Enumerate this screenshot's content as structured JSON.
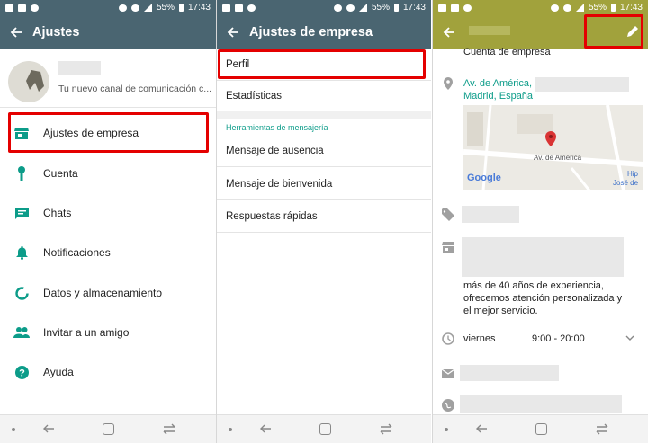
{
  "status_bar": {
    "battery": "55%",
    "time": "17:43"
  },
  "panel1": {
    "title": "Ajustes",
    "profile_status": "Tu nuevo canal de comunicación c...",
    "items": [
      {
        "label": "Ajustes de empresa",
        "icon": "store-icon"
      },
      {
        "label": "Cuenta",
        "icon": "key-icon"
      },
      {
        "label": "Chats",
        "icon": "chat-icon"
      },
      {
        "label": "Notificaciones",
        "icon": "bell-icon"
      },
      {
        "label": "Datos y almacenamiento",
        "icon": "data-usage-icon"
      },
      {
        "label": "Invitar a un amigo",
        "icon": "people-icon"
      },
      {
        "label": "Ayuda",
        "icon": "help-icon"
      }
    ]
  },
  "panel2": {
    "title": "Ajustes de empresa",
    "items": [
      "Perfil",
      "Estadísticas"
    ],
    "section": "Herramientas de mensajería",
    "tools": [
      "Mensaje de ausencia",
      "Mensaje de bienvenida",
      "Respuestas rápidas"
    ]
  },
  "panel3": {
    "category": "Cuenta de empresa",
    "address_line1": "Av. de América,",
    "address_line2": "Madrid, España",
    "map_street": "Av. de América",
    "map_logo": "Google",
    "map_corner1": "Hip",
    "map_corner2": "José de",
    "description": [
      "más de 40 años de experiencia,",
      "ofrecemos atención personalizada y",
      "el mejor servicio."
    ],
    "hours_day": "viernes",
    "hours_time": "9:00 - 20:00"
  },
  "colors": {
    "header": "#4a6571",
    "header_edit": "#a1a23c",
    "accent": "#0c9c89",
    "highlight": "#e40000"
  }
}
